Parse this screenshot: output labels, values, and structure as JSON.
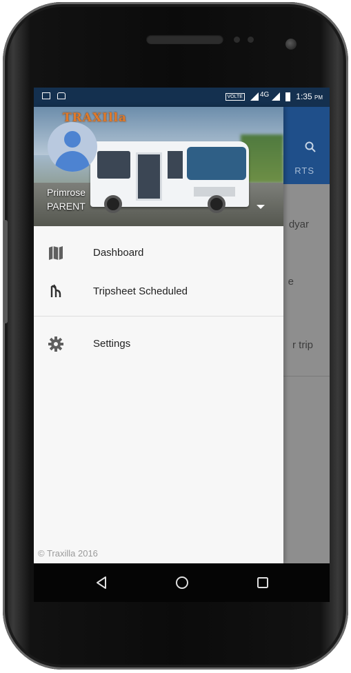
{
  "status_bar": {
    "time": "1:35",
    "ampm": "PM",
    "network": "4G",
    "volte": "VOLTE"
  },
  "app_behind": {
    "tab_fragment": "RTS",
    "row1_fragment": "dyar",
    "row2_fragment": "e",
    "row3_fragment": "r trip"
  },
  "drawer": {
    "logo_text": "TRAXIlla",
    "user": {
      "name": "Primrose",
      "role": "PARENT"
    },
    "menu_primary": [
      {
        "label": "Dashboard",
        "icon": "map-icon"
      },
      {
        "label": "Tripsheet Scheduled",
        "icon": "tripsheet-icon"
      }
    ],
    "menu_secondary": [
      {
        "label": "Settings",
        "icon": "gear-icon"
      }
    ],
    "footer": "© Traxilla 2016"
  },
  "nav_bar": {
    "back": "back-icon",
    "home": "home-icon",
    "recents": "recents-icon"
  },
  "colors": {
    "status_bar": "#14304f",
    "app_toolbar": "#1f4f8a",
    "drawer_bg": "#f7f7f7",
    "scrim": "#8a8a8a",
    "logo_orange": "#e07a2a",
    "avatar_blue": "#4d83d1"
  }
}
